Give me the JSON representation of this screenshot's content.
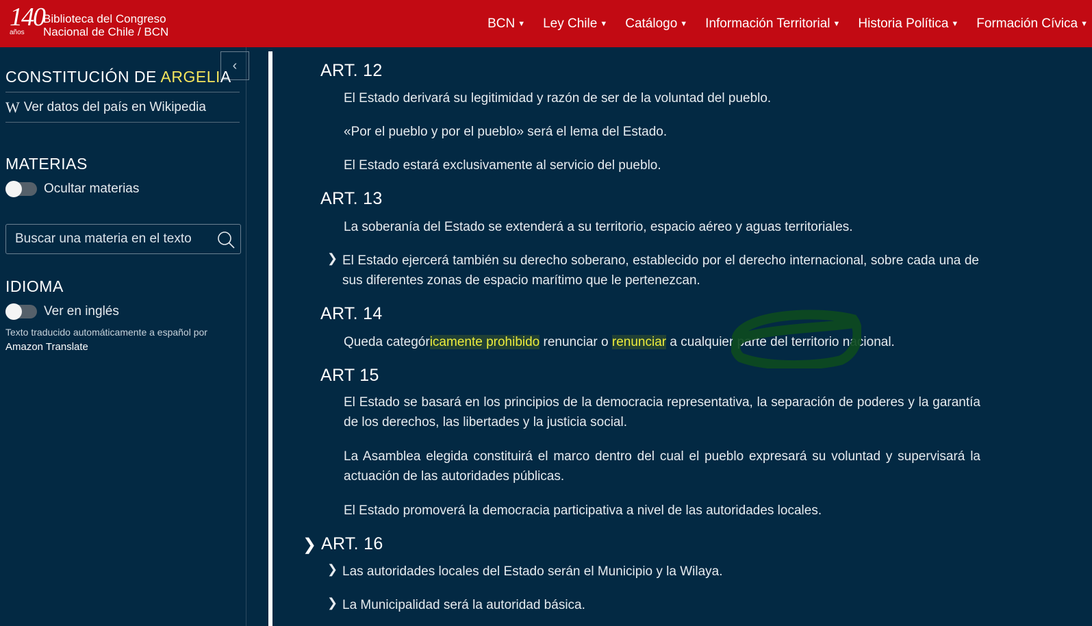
{
  "header": {
    "logo": {
      "number": "140",
      "anos": "años",
      "line1": "Biblioteca del Congreso",
      "line2": "Nacional de Chile / BCN"
    },
    "nav": [
      "BCN",
      "Ley Chile",
      "Catálogo",
      "Información Territorial",
      "Historia Política",
      "Formación Cívica"
    ],
    "colors": {
      "header_bg": "#c20a13",
      "page_bg": "#032943",
      "highlight": "#ecec3c"
    }
  },
  "sidebar": {
    "title_pre": "CONSTITUCIÓN DE ",
    "title_hl": "ARGELI",
    "title_post": "A",
    "wiki_icon": "W",
    "wiki_label": "Ver datos del país en Wikipedia",
    "materias_title": "MATERIAS",
    "materias_toggle": "Ocultar materias",
    "search_placeholder": "Buscar una materia en el texto",
    "idioma_title": "IDIOMA",
    "idioma_toggle": "Ver en inglés",
    "note_line": "Texto traducido automáticamente a español por",
    "note_strong": "Amazon Translate"
  },
  "articles": {
    "a12": {
      "title": "ART. 12",
      "p1": "El Estado derivará su legitimidad y razón de ser de la voluntad del pueblo.",
      "p2": "«Por el pueblo y por el pueblo» será el lema del Estado.",
      "p3": "El Estado estará exclusivamente al servicio del pueblo."
    },
    "a13": {
      "title": "ART. 13",
      "p1": "La soberanía del Estado se extenderá a su territorio, espacio aéreo y aguas territoriales.",
      "p2": "El Estado ejercerá también su derecho soberano, establecido por el derecho internacional, sobre cada una de sus diferentes zonas de espacio marítimo que le pertenezcan."
    },
    "a14": {
      "title": "ART. 14",
      "s1": "Queda categór",
      "s2": "icamente prohibido",
      "s3": " renunciar o ",
      "s4": "renunciar",
      "s5": " a cualquier parte del territorio nacional."
    },
    "a15": {
      "title": "ART 15",
      "p1": "El Estado se basará en los principios de la democracia representativa, la separación de poderes y la garantía de los derechos, las libertades y la justicia social.",
      "p2": "La Asamblea elegida constituirá el marco dentro del cual el pueblo expresará su voluntad y supervisará la actuación de las autoridades públicas.",
      "p3": "El Estado promoverá la democracia participativa a nivel de las autoridades locales."
    },
    "a16": {
      "title": "ART. 16",
      "p1": "Las autoridades locales del Estado serán el Municipio y la Wilaya.",
      "p2": "La Municipalidad será la autoridad básica."
    }
  }
}
